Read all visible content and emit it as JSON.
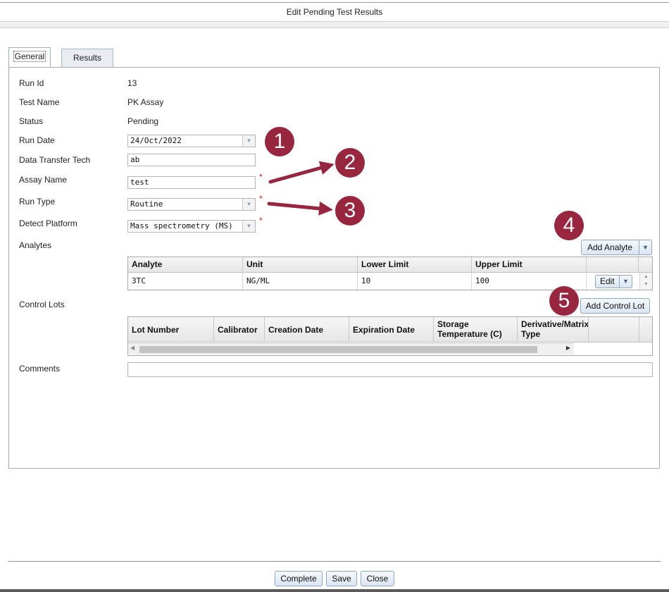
{
  "window": {
    "title": "Edit Pending Test Results"
  },
  "tabs": [
    {
      "label": "General",
      "active": true
    },
    {
      "label": "Results",
      "active": false
    }
  ],
  "form": {
    "run_id": {
      "label": "Run Id",
      "value": "13"
    },
    "test_name": {
      "label": "Test Name",
      "value": "PK Assay"
    },
    "status": {
      "label": "Status",
      "value": "Pending"
    },
    "run_date": {
      "label": "Run Date",
      "value": "24/Oct/2022"
    },
    "data_transfer_tech": {
      "label": "Data Transfer Tech",
      "value": "ab"
    },
    "assay_name": {
      "label": "Assay Name",
      "value": "test",
      "required_mark": "*"
    },
    "run_type": {
      "label": "Run Type",
      "value": "Routine",
      "required_mark": "*"
    },
    "detect_platform": {
      "label": "Detect Platform",
      "value": "Mass spectrometry (MS)",
      "required_mark": "*"
    },
    "analytes_label": "Analytes",
    "control_lots_label": "Control Lots",
    "comments": {
      "label": "Comments",
      "value": ""
    }
  },
  "analytes": {
    "add_button": "Add Analyte",
    "columns": [
      "Analyte",
      "Unit",
      "Lower Limit",
      "Upper Limit"
    ],
    "rows": [
      {
        "analyte": "3TC",
        "unit": "NG/ML",
        "lower": "10",
        "upper": "100",
        "action": "Edit"
      }
    ]
  },
  "control_lots": {
    "add_button": "Add Control Lot",
    "columns": [
      "Lot Number",
      "Calibrator",
      "Creation Date",
      "Expiration Date",
      "Storage Temperature (C)",
      "Derivative/Matrix Type"
    ]
  },
  "annotations": [
    "1",
    "2",
    "3",
    "4",
    "5"
  ],
  "footer": {
    "complete": "Complete",
    "save": "Save",
    "close": "Close"
  },
  "colors": {
    "annotation": "#98263e",
    "required": "#d42020",
    "button_border": "#8fa7c2"
  }
}
